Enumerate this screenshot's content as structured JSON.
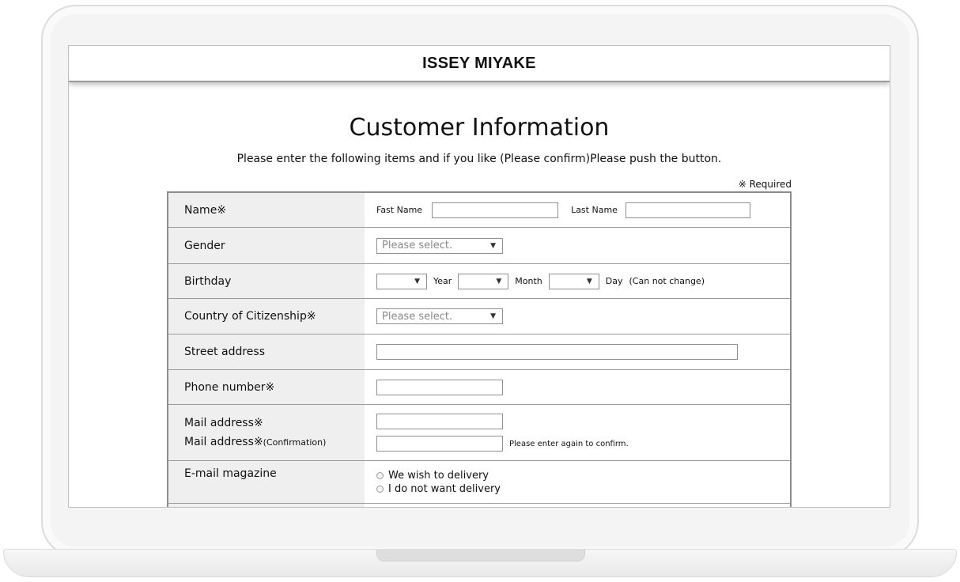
{
  "site": {
    "logo": "ISSEY MIYAKE"
  },
  "page": {
    "title": "Customer Information",
    "instructions": "Please enter the following items and if you like (Please confirm)Please push the button.",
    "required_note": "※ Required"
  },
  "form": {
    "name": {
      "label": "Name※",
      "first_label": "Fast Name",
      "last_label": "Last Name"
    },
    "gender": {
      "label": "Gender",
      "selected": "Please select."
    },
    "birthday": {
      "label": "Birthday",
      "year": "Year",
      "month": "Month",
      "day": "Day",
      "note": "(Can not change)"
    },
    "country": {
      "label": "Country of Citizenship※",
      "selected": "Please select."
    },
    "street": {
      "label": "Street address"
    },
    "phone": {
      "label": "Phone number※"
    },
    "mail": {
      "label": "Mail address※",
      "confirm_label": "Mail address※",
      "confirm_suffix": "(Confirmation)",
      "hint": "Please enter again to confirm."
    },
    "magazine": {
      "label": "E-mail magazine",
      "option_yes": "We wish to delivery",
      "option_no": "I do not want delivery"
    }
  },
  "icons": {
    "dropdown": "▼"
  }
}
